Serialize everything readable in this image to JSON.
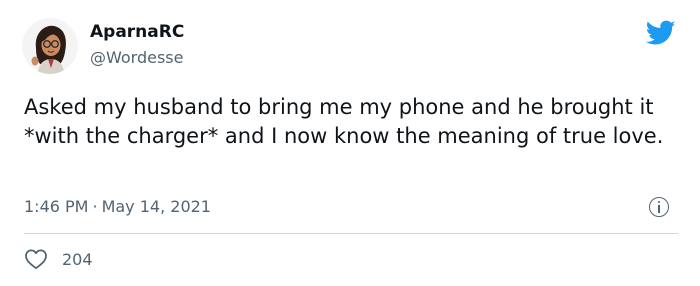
{
  "tweet": {
    "display_name": "AparnaRC",
    "handle": "@Wordesse",
    "text": "Asked my husband to bring me my phone and he brought it *with the charger* and I now know the meaning of true love.",
    "time": "1:46 PM",
    "separator": "·",
    "date": "May 14, 2021",
    "like_count": "204"
  },
  "icons": {
    "brand": "twitter-bird-icon",
    "info": "info-icon",
    "like": "heart-icon"
  },
  "colors": {
    "brand_blue": "#1d9bf0",
    "text_primary": "#0f1419",
    "text_secondary": "#536471",
    "divider": "#cfd9de"
  }
}
